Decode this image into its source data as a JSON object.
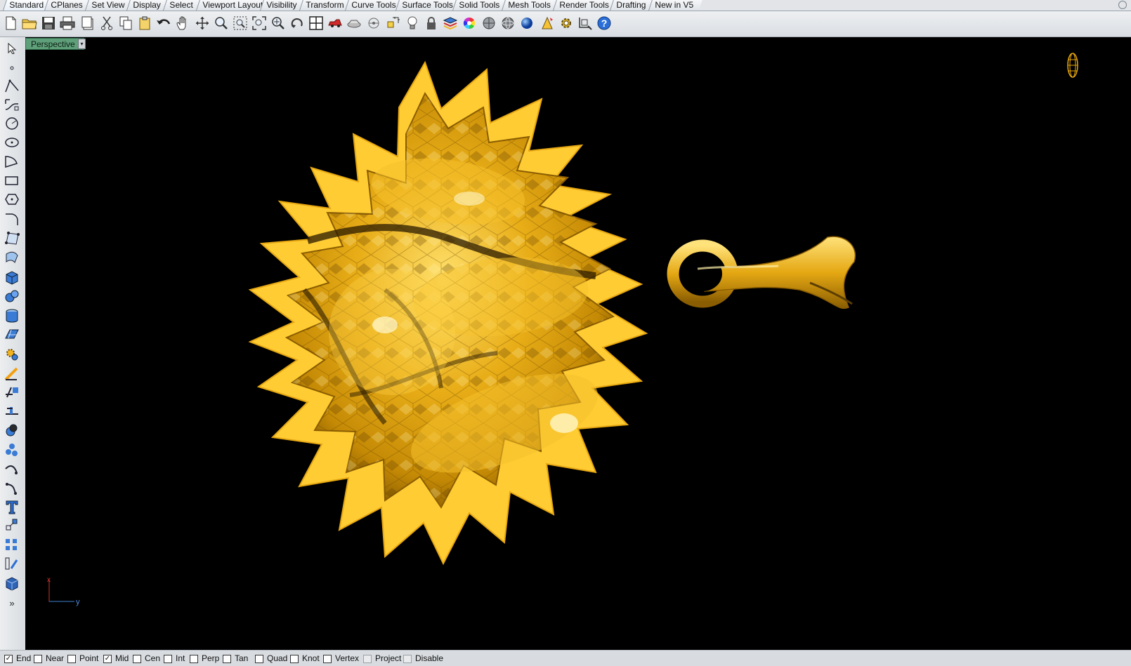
{
  "tabs": [
    {
      "label": "Standard",
      "active": true
    },
    {
      "label": "CPlanes"
    },
    {
      "label": "Set View"
    },
    {
      "label": "Display"
    },
    {
      "label": "Select"
    },
    {
      "label": "Viewport Layout"
    },
    {
      "label": "Visibility"
    },
    {
      "label": "Transform"
    },
    {
      "label": "Curve Tools"
    },
    {
      "label": "Surface Tools"
    },
    {
      "label": "Solid Tools"
    },
    {
      "label": "Mesh Tools"
    },
    {
      "label": "Render Tools"
    },
    {
      "label": "Drafting"
    },
    {
      "label": "New in V5"
    }
  ],
  "toolbar": {
    "icons": [
      "new-document-icon",
      "open-folder-icon",
      "save-icon",
      "print-icon",
      "properties-icon",
      "cut-icon",
      "copy-icon",
      "paste-icon",
      "undo-icon",
      "pan-hand-icon",
      "move-view-icon",
      "zoom-icon",
      "zoom-window-icon",
      "zoom-extents-icon",
      "zoom-selected-icon",
      "rotate-view-icon",
      "four-viewports-icon",
      "car-icon",
      "named-view-icon",
      "ortho-circle-icon",
      "grid-snap-icon",
      "light-bulb-icon",
      "lock-icon",
      "layer-icon",
      "color-wheel-icon",
      "shaded-sphere-icon",
      "rendered-sphere-icon",
      "blue-sphere-icon",
      "render-cone-icon",
      "options-gear-icon",
      "dimension-icon",
      "help-icon"
    ]
  },
  "left_toolbar": {
    "icons": [
      "select-arrow-icon",
      "point-icon",
      "polyline-icon",
      "curve-icon",
      "circle-icon",
      "ellipse-icon",
      "arc-icon",
      "rectangle-icon",
      "polygon-icon",
      "fillet-curve-icon",
      "surface-from-points-icon",
      "extrude-surface-icon",
      "box-solid-icon",
      "sphere-solid-icon",
      "cylinder-solid-icon",
      "planar-surface-icon",
      "boolean-gear-icon",
      "trim-icon",
      "split-icon",
      "extend-icon",
      "solid-union-icon",
      "group-icon",
      "rebuild-curve-icon",
      "blend-curve-icon",
      "text-icon",
      "transform-icon",
      "array-icon",
      "dimension-tool-icon",
      "box-3d-icon",
      "more-chevron-icon"
    ]
  },
  "viewport": {
    "title": "Perspective",
    "dropdown_glyph": "▾",
    "axis_x": "x",
    "axis_y": "y"
  },
  "statusbar": {
    "osnaps": [
      {
        "label": "End",
        "checked": true
      },
      {
        "label": "Near",
        "checked": false
      },
      {
        "label": "Point",
        "checked": false
      },
      {
        "label": "Mid",
        "checked": true
      },
      {
        "label": "Cen",
        "checked": false
      },
      {
        "label": "Int",
        "checked": false
      },
      {
        "label": "Perp",
        "checked": false
      },
      {
        "label": "Tan",
        "checked": false
      },
      {
        "label": "Quad",
        "checked": false
      },
      {
        "label": "Knot",
        "checked": false
      },
      {
        "label": "Vertex",
        "checked": false
      },
      {
        "label": "Project",
        "checked": false,
        "disabled": true
      },
      {
        "label": "Disable",
        "checked": false,
        "disabled": true
      }
    ]
  },
  "colors": {
    "viewport_bg": "#000000",
    "gold_light": "#ffd84a",
    "gold_mid": "#e8b21a",
    "gold_dark": "#7a5200",
    "viewport_title_bg": "#5fa07a"
  }
}
